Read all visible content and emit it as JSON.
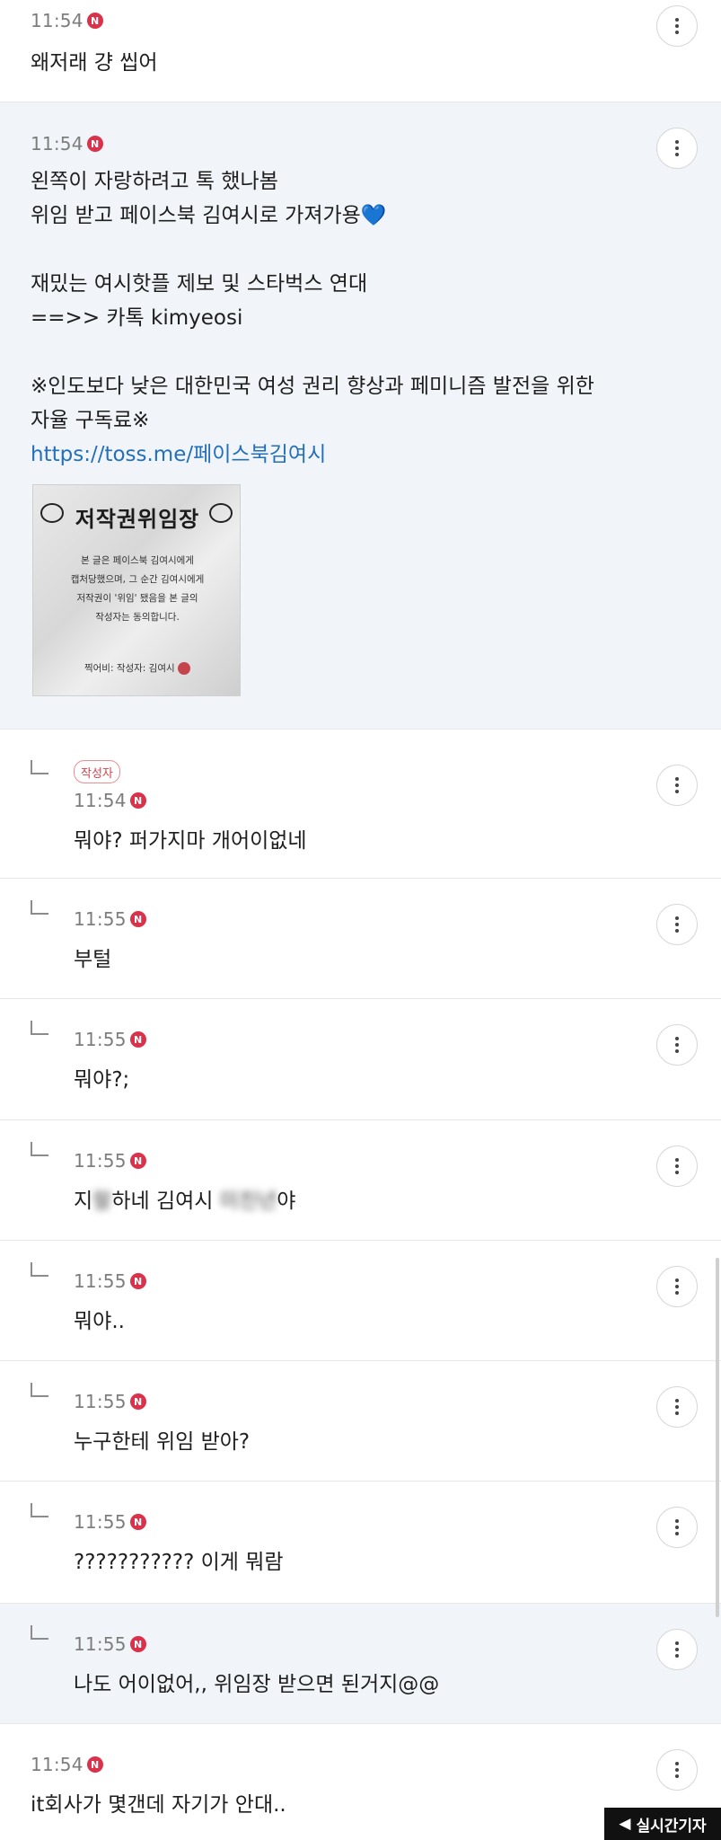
{
  "comments": [
    {
      "time": "11:54",
      "badge": "N",
      "lines": [
        "왜저래 걍 씹어"
      ]
    },
    {
      "time": "11:54",
      "badge": "N",
      "line1": "왼쪽이 자랑하려고 톡 했나봄",
      "line2": "위임 받고 페이스북 김여시로 가져가용",
      "line2_heart": "💙",
      "line3": "재밌는 여시핫플 제보 및 스타벅스 연대",
      "line4": "==>> 카톡 kimyeosi",
      "line5": "※인도보다 낮은 대한민국 여성 권리 향상과 페미니즘 발전을 위한",
      "line6": "자율 구독료※",
      "link": "https://toss.me/페이스북김여시",
      "certificate": {
        "title": "저작권위임장",
        "body": [
          "본 글은 페이스북 김여시에게",
          "캡처당했으며, 그 순간 김여시에게",
          "저작권이 '위임' 됐음을 본 글의",
          "작성자는 동의합니다."
        ],
        "sign": "찍어비: 작성자: 김여시"
      }
    },
    {
      "time": "11:54",
      "badge": "N",
      "author_badge": "작성자",
      "text": "뭐야? 퍼가지마 개어이없네"
    },
    {
      "time": "11:55",
      "badge": "N",
      "text": "부털"
    },
    {
      "time": "11:55",
      "badge": "N",
      "text": "뭐야?;"
    },
    {
      "time": "11:55",
      "badge": "N",
      "text_pre": "지",
      "text_blur1": "랄",
      "text_mid": "하네 김여시 ",
      "text_blur2": "미친년",
      "text_post": "야"
    },
    {
      "time": "11:55",
      "badge": "N",
      "text": "뭐야.."
    },
    {
      "time": "11:55",
      "badge": "N",
      "text": "누구한테 위임 받아?"
    },
    {
      "time": "11:55",
      "badge": "N",
      "text": "??????????? 이게 뭐람"
    },
    {
      "time": "11:55",
      "badge": "N",
      "text": "나도 어이없어,, 위임장 받으면 된거지@@"
    },
    {
      "time": "11:54",
      "badge": "N",
      "text": "it회사가 몇갠데 자기가 안대.."
    }
  ],
  "watermark": "실시간기자",
  "colors": {
    "new_badge": "#d9324a",
    "link": "#2470b8",
    "highlight_bg": "#f1f5f9"
  },
  "icons": {
    "more": "more-vertical-icon",
    "reply": "reply-arrow-icon"
  }
}
